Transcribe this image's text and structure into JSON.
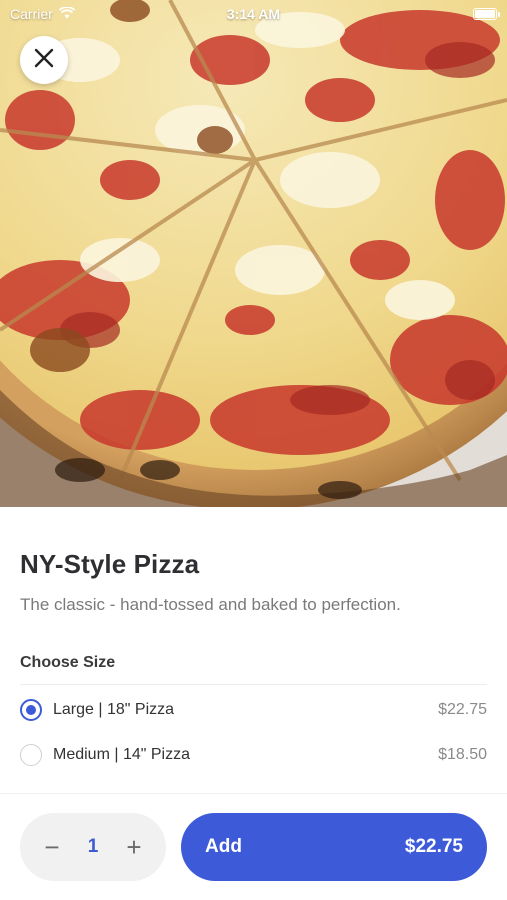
{
  "status_bar": {
    "carrier": "Carrier",
    "time": "3:14 AM"
  },
  "hero": {
    "image": "ny-style-pizza-photo"
  },
  "close_button": {
    "icon": "close-icon"
  },
  "item": {
    "title": "NY-Style Pizza",
    "description": "The classic - hand-tossed and baked to perfection."
  },
  "size_section": {
    "header": "Choose Size",
    "options": [
      {
        "label": "Large | 18\" Pizza",
        "price": "$22.75",
        "selected": true
      },
      {
        "label": "Medium | 14\" Pizza",
        "price": "$18.50",
        "selected": false
      }
    ]
  },
  "cart": {
    "decrement_symbol": "−",
    "quantity": "1",
    "increment_symbol": "+",
    "add_label": "Add",
    "add_total": "$22.75"
  },
  "colors": {
    "accent": "#3d5ad8",
    "stepper_bg": "#f1f1f2"
  }
}
